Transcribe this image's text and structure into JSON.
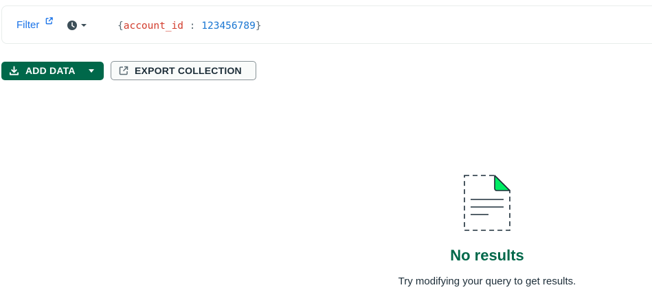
{
  "filter_bar": {
    "filter_label": "Filter",
    "history_icon": "clock-icon",
    "query": {
      "open_brace": "{",
      "key": "account_id",
      "separator": " : ",
      "value": "123456789",
      "close_brace": "}"
    }
  },
  "toolbar": {
    "add_data_label": "ADD DATA",
    "export_label": "EXPORT COLLECTION"
  },
  "empty_state": {
    "title": "No results",
    "subtitle": "Try modifying your query to get results."
  },
  "colors": {
    "brand_green": "#00684a",
    "accent_green": "#00ed64",
    "link_blue": "#1a73e8",
    "query_key": "#d23c2c",
    "query_value": "#1976d2"
  }
}
